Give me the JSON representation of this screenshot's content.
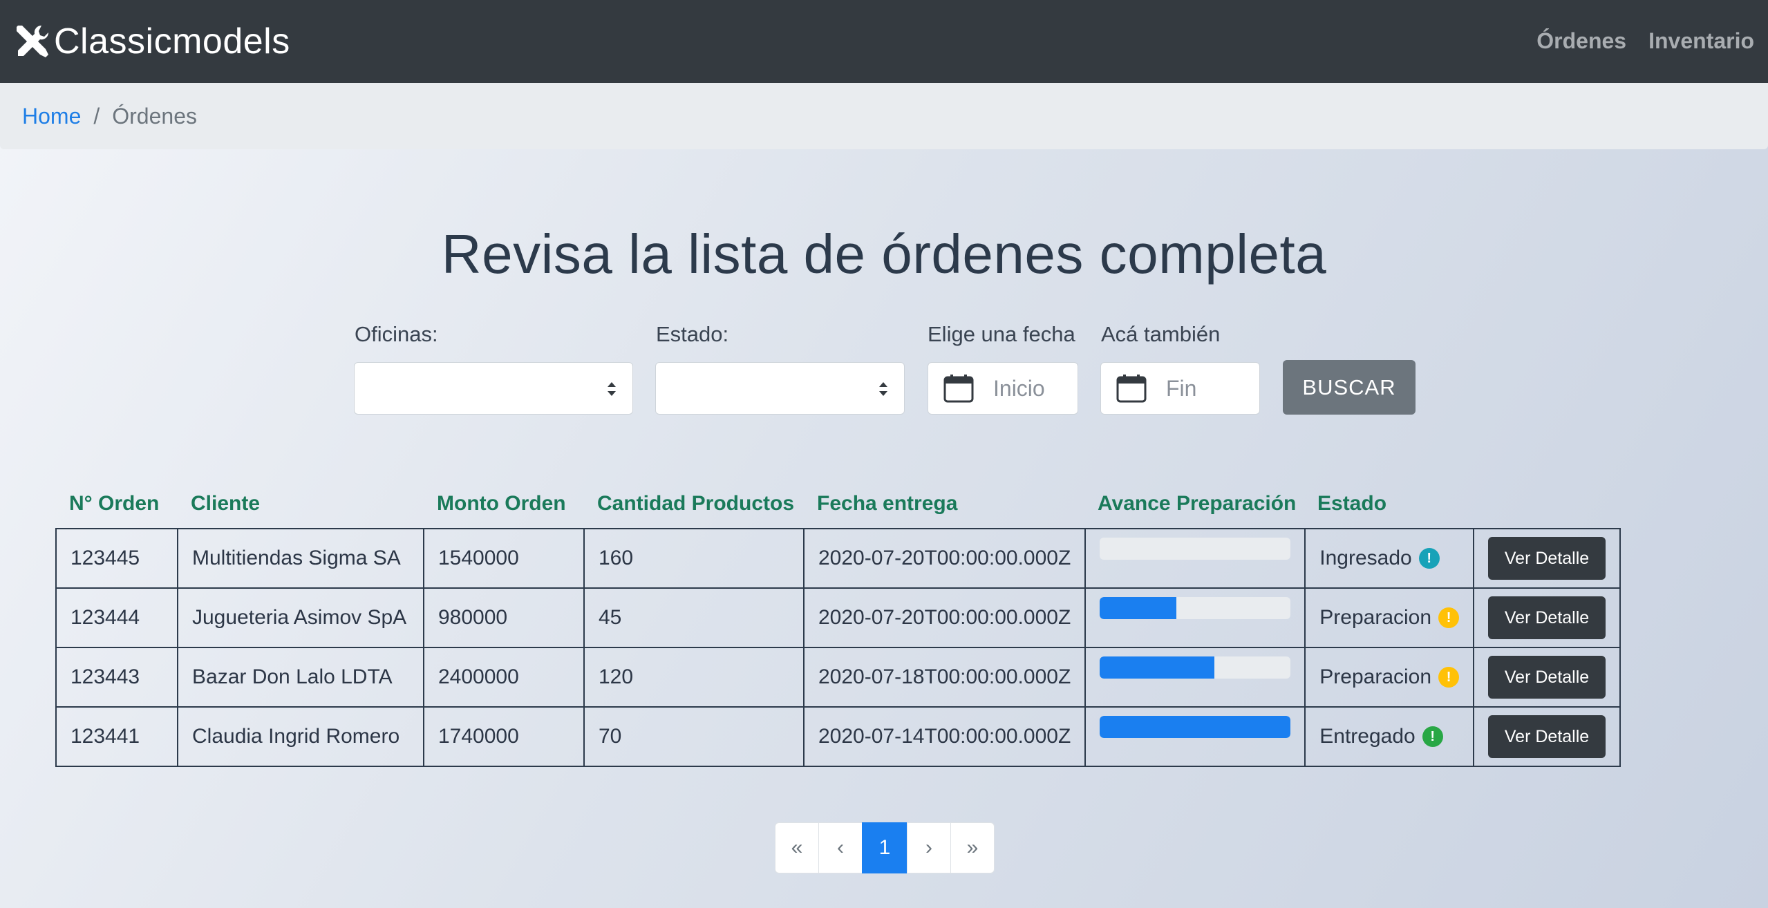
{
  "navbar": {
    "brand": "Classicmodels",
    "brand_icon": "tools-icon",
    "links": [
      "Órdenes",
      "Inventario"
    ]
  },
  "breadcrumb": {
    "home": "Home",
    "separator": "/",
    "current": "Órdenes"
  },
  "page_title": "Revisa la lista de órdenes completa",
  "filters": {
    "oficinas_label": "Oficinas:",
    "oficinas_value": "",
    "estado_label": "Estado:",
    "estado_value": "",
    "fecha_label": "Elige una fecha",
    "fecha_inicio_placeholder": "Inicio",
    "fecha_fin_label": "Acá también",
    "fecha_fin_placeholder": "Fin",
    "buscar_label": "BUSCAR"
  },
  "table": {
    "headers": [
      "N° Orden",
      "Cliente",
      "Monto Orden",
      "Cantidad Productos",
      "Fecha entrega",
      "Avance Preparación",
      "Estado"
    ],
    "detail_button_label": "Ver Detalle",
    "rows": [
      {
        "orden": "123445",
        "cliente": "Multitiendas Sigma SA",
        "monto": "1540000",
        "cantidad": "160",
        "fecha": "2020-07-20T00:00:00.000Z",
        "avance_pct": 0,
        "estado": "Ingresado",
        "estado_color": "#17a2b8",
        "estado_icon": "!"
      },
      {
        "orden": "123444",
        "cliente": "Jugueteria Asimov SpA",
        "monto": "980000",
        "cantidad": "45",
        "fecha": "2020-07-20T00:00:00.000Z",
        "avance_pct": 40,
        "estado": "Preparacion",
        "estado_color": "#ffc107",
        "estado_icon": "!"
      },
      {
        "orden": "123443",
        "cliente": "Bazar Don Lalo LDTA",
        "monto": "2400000",
        "cantidad": "120",
        "fecha": "2020-07-18T00:00:00.000Z",
        "avance_pct": 60,
        "estado": "Preparacion",
        "estado_color": "#ffc107",
        "estado_icon": "!"
      },
      {
        "orden": "123441",
        "cliente": "Claudia Ingrid Romero",
        "monto": "1740000",
        "cantidad": "70",
        "fecha": "2020-07-14T00:00:00.000Z",
        "avance_pct": 100,
        "estado": "Entregado",
        "estado_color": "#28a745",
        "estado_icon": "!"
      }
    ]
  },
  "pagination": {
    "first": "«",
    "prev": "‹",
    "current": "1",
    "next": "›",
    "last": "»"
  },
  "colors": {
    "accent": "#1a7ff0",
    "header_text": "#1a7a5a",
    "navbar": "#343a40"
  }
}
